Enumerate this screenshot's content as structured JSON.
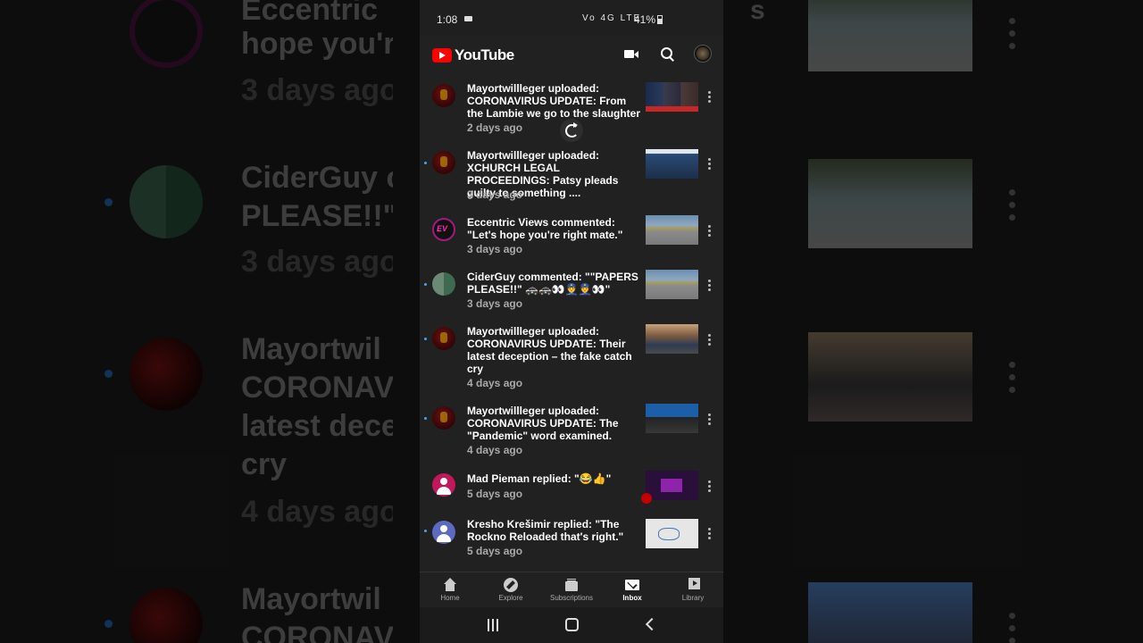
{
  "status_bar": {
    "time": "1:08",
    "net_icons": "Vo 4G LTE",
    "battery": "41%"
  },
  "app_bar": {
    "logo_text": "YouTube",
    "icons": [
      "video-camera-icon",
      "search-icon",
      "account-avatar"
    ]
  },
  "notifications": [
    {
      "text": "Mayortwillleger uploaded: CORONAVIRUS UPDATE: From the Lambie we go to the slaughter",
      "time": "2 days ago",
      "unread": false,
      "avatar": "red",
      "thumb": "news"
    },
    {
      "text": "Mayortwillleger uploaded: XCHURCH LEGAL PROCEEDINGS: Patsy pleads guilty to something ....",
      "time": "3 days ago",
      "unread": true,
      "avatar": "red",
      "thumb": "zoom"
    },
    {
      "text": "Eccentric Views commented: \"Let's hope you're right mate.\"",
      "time": "3 days ago",
      "unread": false,
      "avatar": "ev",
      "thumb": "road"
    },
    {
      "text": "CiderGuy commented: \"\"PAPERS PLEASE!!\" 🚓🚓👀👮👮👀\"",
      "time": "3 days ago",
      "unread": true,
      "avatar": "green",
      "thumb": "road"
    },
    {
      "text": "Mayortwillleger uploaded: CORONAVIRUS UPDATE: Their latest deception – the fake catch cry",
      "time": "4 days ago",
      "unread": true,
      "avatar": "red",
      "thumb": "person"
    },
    {
      "text": "Mayortwillleger uploaded: CORONAVIRUS UPDATE: The \"Pandemic\" word examined.",
      "time": "4 days ago",
      "unread": true,
      "avatar": "red",
      "thumb": "who"
    },
    {
      "text": "Mad Pieman replied: \"😂👍\"",
      "time": "5 days ago",
      "unread": false,
      "avatar": "pink",
      "thumb": "purple"
    },
    {
      "text": "Kresho Krešimir replied: \"The Rockno Reloaded that's right.\"",
      "time": "5 days ago",
      "unread": true,
      "avatar": "blue",
      "thumb": "whiteboard"
    }
  ],
  "bottom_nav": [
    {
      "label": "Home",
      "icon": "home-icon"
    },
    {
      "label": "Explore",
      "icon": "explore-icon"
    },
    {
      "label": "Subscriptions",
      "icon": "subscriptions-icon"
    },
    {
      "label": "Inbox",
      "icon": "inbox-icon",
      "active": true
    },
    {
      "label": "Library",
      "icon": "library-icon"
    }
  ],
  "background": {
    "left_rows": [
      {
        "lines": [
          "Eccentric",
          "hope you'r"
        ],
        "time": "3 days ago"
      },
      {
        "lines": [
          "CiderGuy c",
          "PLEASE!!\""
        ],
        "time": "3 days ago"
      },
      {
        "lines": [
          "Mayortwil",
          "CORONAV",
          "latest dece",
          "cry"
        ],
        "time": "4 days ago"
      },
      {
        "lines": [
          "Mayortwil",
          "CORONAV"
        ],
        "time": ""
      }
    ],
    "right_fragment": "s"
  },
  "colors": {
    "phone_bg": "#212121",
    "accent_red": "#ff0000",
    "unread_dot": "#3ea6ff",
    "secondary_text": "#aaaaaa"
  }
}
